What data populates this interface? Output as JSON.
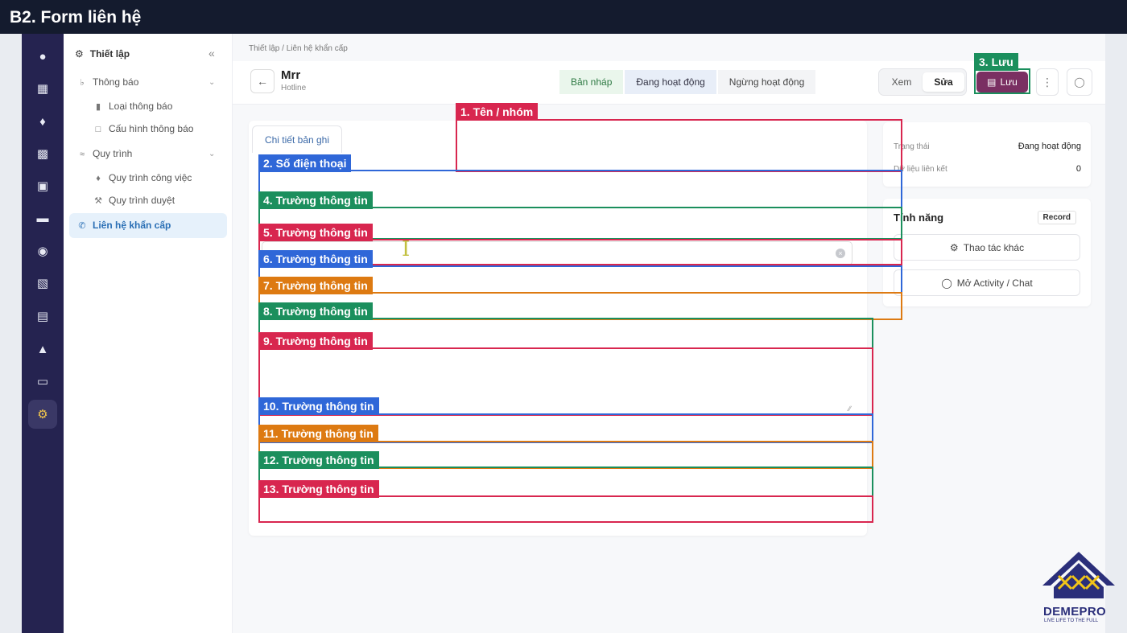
{
  "slide_title": "B2. Form liên hệ",
  "sidebar": {
    "header": "Thiết lập",
    "items": [
      {
        "label": "Thông báo"
      },
      {
        "label": "Loại thông báo"
      },
      {
        "label": "Cấu hình thông báo"
      },
      {
        "label": "Quy trình"
      },
      {
        "label": "Quy trình công việc"
      },
      {
        "label": "Quy trình duyệt"
      },
      {
        "label": "Liên hệ khẩn cấp"
      }
    ]
  },
  "breadcrumb": "Thiết lập  /  Liên hệ khẩn cấp",
  "record": {
    "name": "Mrr",
    "subtitle": "Hotline"
  },
  "status_steps": [
    "Bản nháp",
    "Đang hoạt động",
    "Ngừng hoạt động"
  ],
  "view_toggle": {
    "view": "Xem",
    "edit": "Sửa"
  },
  "save_label": "Lưu",
  "form_tab": "Chi tiết bản ghi",
  "status_card": {
    "status_label": "Trạng thái",
    "status_value": "Đang hoạt động",
    "linked_label": "Dữ liệu liên kết",
    "linked_value": "0"
  },
  "feature_card": {
    "title": "Tính năng",
    "badge": "Record",
    "more_actions": "Thao tác khác",
    "open_chat": "Mở Activity / Chat"
  },
  "annotations": [
    "1. Tên / nhóm",
    "2. Số điện thoại",
    "3. Lưu",
    "4. Trường thông tin",
    "5. Trường thông tin",
    "6. Trường thông tin",
    "7. Trường thông tin",
    "8. Trường thông tin",
    "9. Trường thông tin",
    "10. Trường thông tin",
    "11. Trường thông tin",
    "12. Trường thông tin",
    "13. Trường thông tin"
  ],
  "logo": {
    "name": "DEMEPRO",
    "tagline": "LIVE LIFE TO THE FULL"
  },
  "colors": {
    "accent": "#7a2f62",
    "rail": "#252350",
    "annotation_red": "#d8264f",
    "annotation_blue": "#2f67d8",
    "annotation_green": "#1b8f5d",
    "annotation_orange": "#dd7a12"
  }
}
